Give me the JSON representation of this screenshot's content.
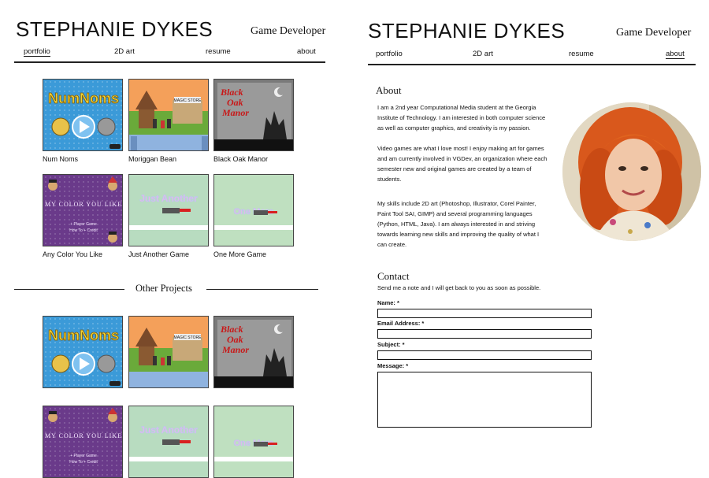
{
  "left": {
    "title": "STEPHANIE DYKES",
    "subtitle": "Game Developer",
    "nav": [
      "portfolio",
      "2D art",
      "resume",
      "about"
    ],
    "games": [
      "Num Noms",
      "Moriggan Bean",
      "Black Oak Manor",
      "Any Color You Like",
      "Just Another Game",
      "One More Game"
    ],
    "other_heading": "Other Projects"
  },
  "right": {
    "title": "STEPHANIE DYKES",
    "subtitle": "Game Developer",
    "nav": [
      "portfolio",
      "2D art",
      "resume",
      "about"
    ],
    "about_heading": "About",
    "about_p1_lines": [
      "I am a 2nd year Computational Media student at the Georgia",
      "Institute of Technology. I am interested in both computer science",
      "as well as computer graphics, and creativity is my passion."
    ],
    "about_p2_lines": [
      "Video games are what I love most! I enjoy making art for games",
      "and am currently involved in VGDev, an organization where each",
      "semester new and original games are created by a team of",
      "students."
    ],
    "about_p3_lines": [
      "My skills include 2D art (Photoshop, Illustrator, Corel Painter,",
      "Paint Tool SAI, GIMP) and several programming languages",
      "(Python, HTML, Java). I am always interested in and striving",
      "towards learning new skills and improving the quality of what I",
      "can create."
    ],
    "contact_heading": "Contact",
    "contact_intro": "Send me a note and I will get back to you as soon as possible.",
    "fields": {
      "name": "Name: *",
      "email": "Email Address: *",
      "subject": "Subject: *",
      "message": "Message: *"
    }
  },
  "thumb_text": {
    "numnoms": "NumNoms",
    "store": "MAGIC STORE",
    "blackoak": [
      "Black",
      "Oak",
      "Manor"
    ],
    "colorgame": "MY COLOR YOU LIKE",
    "colorgame_sub": [
      "+ Player Game",
      "How To + Credit"
    ],
    "jag": "Just Another",
    "omg": "One More"
  },
  "colors": {
    "text": "#111111",
    "rule": "#222222",
    "border": "#444444"
  }
}
